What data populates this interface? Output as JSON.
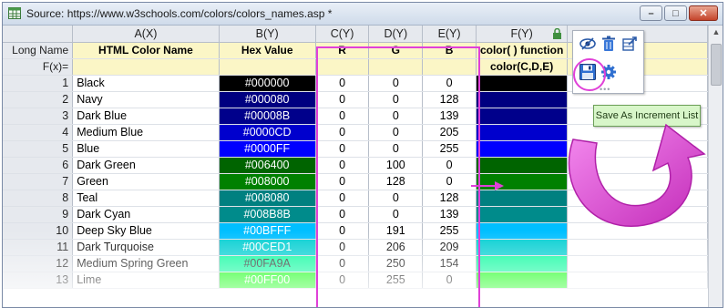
{
  "window": {
    "title": "Source: https://www.w3schools.com/colors/colors_names.asp  *",
    "buttons": [
      "minimize",
      "maximize",
      "close"
    ]
  },
  "columns": [
    "A(X)",
    "B(Y)",
    "C(Y)",
    "D(Y)",
    "E(Y)",
    "F(Y)"
  ],
  "long_name_label": "Long Name",
  "long_names": [
    "HTML Color Name",
    "Hex Value",
    "R",
    "G",
    "B",
    "color( ) function"
  ],
  "fx_label": "F(x)=",
  "fx_values": [
    "",
    "",
    "",
    "",
    "",
    "color(C,D,E)"
  ],
  "rows": [
    {
      "n": "1",
      "name": "Black",
      "hex": "#000000",
      "r": "0",
      "g": "0",
      "b": "0"
    },
    {
      "n": "2",
      "name": "Navy",
      "hex": "#000080",
      "r": "0",
      "g": "0",
      "b": "128"
    },
    {
      "n": "3",
      "name": "Dark Blue",
      "hex": "#00008B",
      "r": "0",
      "g": "0",
      "b": "139"
    },
    {
      "n": "4",
      "name": "Medium Blue",
      "hex": "#0000CD",
      "r": "0",
      "g": "0",
      "b": "205"
    },
    {
      "n": "5",
      "name": "Blue",
      "hex": "#0000FF",
      "r": "0",
      "g": "0",
      "b": "255"
    },
    {
      "n": "6",
      "name": "Dark Green",
      "hex": "#006400",
      "r": "0",
      "g": "100",
      "b": "0"
    },
    {
      "n": "7",
      "name": "Green",
      "hex": "#008000",
      "r": "0",
      "g": "128",
      "b": "0"
    },
    {
      "n": "8",
      "name": "Teal",
      "hex": "#008080",
      "r": "0",
      "g": "0",
      "b": "128"
    },
    {
      "n": "9",
      "name": "Dark Cyan",
      "hex": "#008B8B",
      "r": "0",
      "g": "0",
      "b": "139"
    },
    {
      "n": "10",
      "name": "Deep Sky Blue",
      "hex": "#00BFFF",
      "r": "0",
      "g": "191",
      "b": "255"
    },
    {
      "n": "11",
      "name": "Dark Turquoise",
      "hex": "#00CED1",
      "r": "0",
      "g": "206",
      "b": "209"
    },
    {
      "n": "12",
      "name": "Medium Spring Green",
      "hex": "#00FA9A",
      "r": "0",
      "g": "250",
      "b": "154"
    },
    {
      "n": "13",
      "name": "Lime",
      "hex": "#00FF00",
      "r": "0",
      "g": "255",
      "b": "0"
    }
  ],
  "popup": {
    "icons": [
      "show-hide-icon",
      "delete-icon",
      "export-icon",
      "save-icon",
      "settings-icon"
    ],
    "tooltip": "Save As Increment List"
  },
  "accent_color": "#e040d8"
}
